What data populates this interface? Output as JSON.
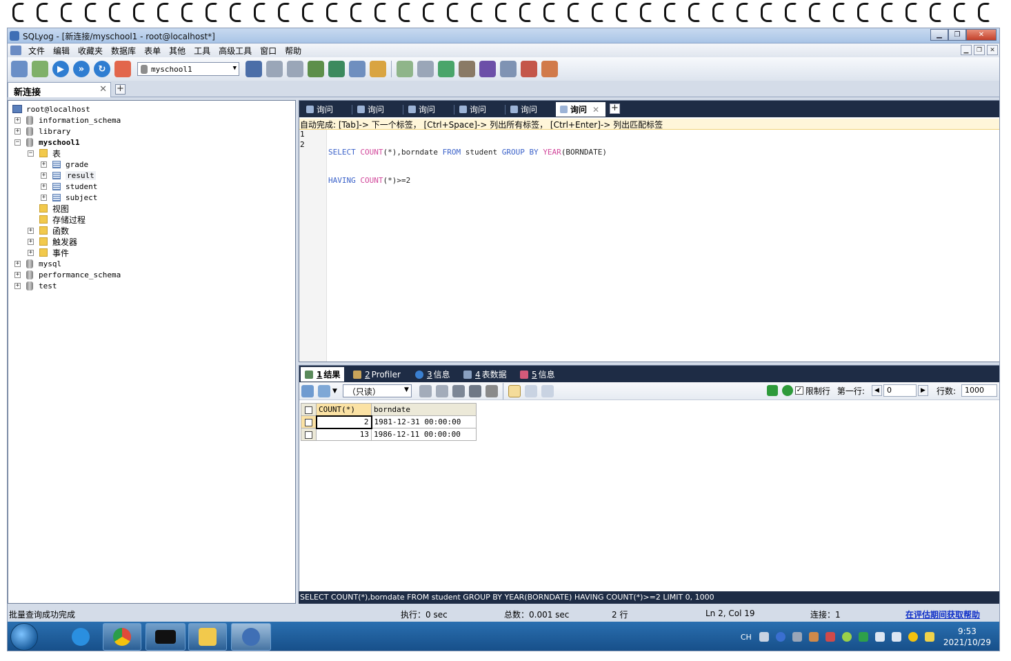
{
  "window": {
    "title": "SQLyog - [新连接/myschool1 - root@localhost*]"
  },
  "menu": [
    "文件",
    "编辑",
    "收藏夹",
    "数据库",
    "表单",
    "其他",
    "工具",
    "高级工具",
    "窗口",
    "帮助"
  ],
  "toolbar": {
    "database_select": "myschool1"
  },
  "connection_tab": {
    "label": "新连接"
  },
  "tree": {
    "root": "root@localhost",
    "nodes": [
      "information_schema",
      "library",
      "myschool1",
      "表",
      "grade",
      "result",
      "student",
      "subject",
      "视图",
      "存储过程",
      "函数",
      "触发器",
      "事件",
      "mysql",
      "performance_schema",
      "test"
    ]
  },
  "query_tabs": [
    "询问",
    "询问",
    "询问",
    "询问",
    "询问",
    "询问"
  ],
  "editor": {
    "hint": "自动完成: [Tab]-> 下一个标签， [Ctrl+Space]-> 列出所有标签， [Ctrl+Enter]-> 列出匹配标签",
    "line_numbers": [
      "1",
      "2"
    ],
    "tokens": {
      "select": "SELECT",
      "count": "COUNT",
      "count_args": "(*),borndate ",
      "from": "FROM",
      "student": " student ",
      "group_by": "GROUP BY",
      "year": "YEAR",
      "year_args": "(BORNDATE)",
      "having": "HAVING",
      "having_args": "(*)>=2"
    }
  },
  "result_tabs": [
    {
      "num": "1",
      "label": "结果"
    },
    {
      "num": "2",
      "label": "Profiler"
    },
    {
      "num": "3",
      "label": "信息"
    },
    {
      "num": "4",
      "label": "表数据"
    },
    {
      "num": "5",
      "label": "信息"
    }
  ],
  "result_toolbar": {
    "mode": "（只读）",
    "limit_rows_label": "限制行",
    "first_row_label": "第一行:",
    "first_row_value": "0",
    "rows_label": "行数:",
    "rows_value": "1000"
  },
  "result_grid": {
    "columns": [
      "COUNT(*)",
      "borndate"
    ],
    "rows": [
      [
        "2",
        "1981-12-31 00:00:00"
      ],
      [
        "13",
        "1986-12-11 00:00:00"
      ]
    ]
  },
  "sql_footer": "SELECT COUNT(*),borndate FROM student GROUP BY YEAR(BORNDATE) HAVING COUNT(*)>=2 LIMIT 0, 1000",
  "status": {
    "message": "批量查询成功完成",
    "exec": "执行：0 sec",
    "total": "总数：0.001 sec",
    "rows": "2 行",
    "position": "Ln 2, Col 19",
    "connection": "连接：1",
    "help_link": "在评估期间获取帮助"
  },
  "taskbar": {
    "tray_lang": "CH",
    "time": "9:53",
    "date": "2021/10/29"
  },
  "colors": {
    "keyword": "#3b62c9",
    "function": "#d1479a",
    "tabbar": "#1e2c45",
    "hint_bg": "#fff6d9"
  }
}
